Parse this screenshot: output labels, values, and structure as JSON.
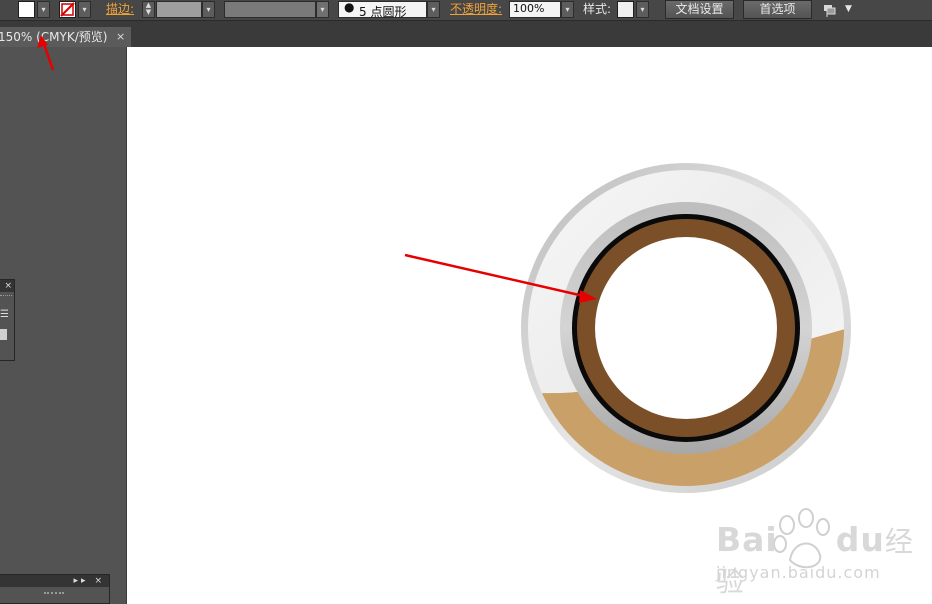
{
  "control_bar": {
    "stroke_label": "描边:",
    "brush_label": "5 点圆形",
    "opacity_label": "不透明度:",
    "opacity_value": "100%",
    "style_label": "样式:",
    "doc_setup_button": "文档设置",
    "preferences_button": "首选项"
  },
  "document_tab": {
    "title": "150% (CMYK/预览)",
    "close": "×"
  },
  "panels": {
    "close_glyph": "×",
    "collapse_glyph": "▸▸"
  },
  "watermark": {
    "brand": "Bai",
    "brand_end": "du",
    "suffix": "经验",
    "url": "jingyan.baidu.com"
  },
  "colors": {
    "ring_brown": "#7b5028",
    "band_tan": "#c9a068",
    "ring_black": "#0a0a0a",
    "annotation_red": "#e60000"
  }
}
